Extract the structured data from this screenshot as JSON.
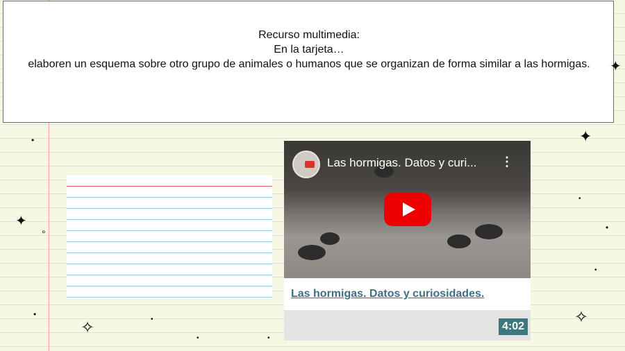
{
  "card": {
    "line1": "Recurso multimedia:",
    "line2": "En la tarjeta…",
    "line3": "elaboren un esquema sobre otro grupo de animales o humanos que se organizan de forma similar a las hormigas."
  },
  "video": {
    "overlay_title": "Las hormigas. Datos y curi...",
    "menu_icon": "⋮",
    "link_text": "Las hormigas. Datos y curiosidades.",
    "duration": "4:02"
  },
  "icons": {
    "play": "play-icon",
    "sparkle": "✦",
    "sparkle_outline": "✧",
    "dot": "•",
    "circle": "°"
  },
  "colors": {
    "play_red": "#ee0000",
    "link": "#3f6f80",
    "duration_bg": "#3f7780"
  }
}
